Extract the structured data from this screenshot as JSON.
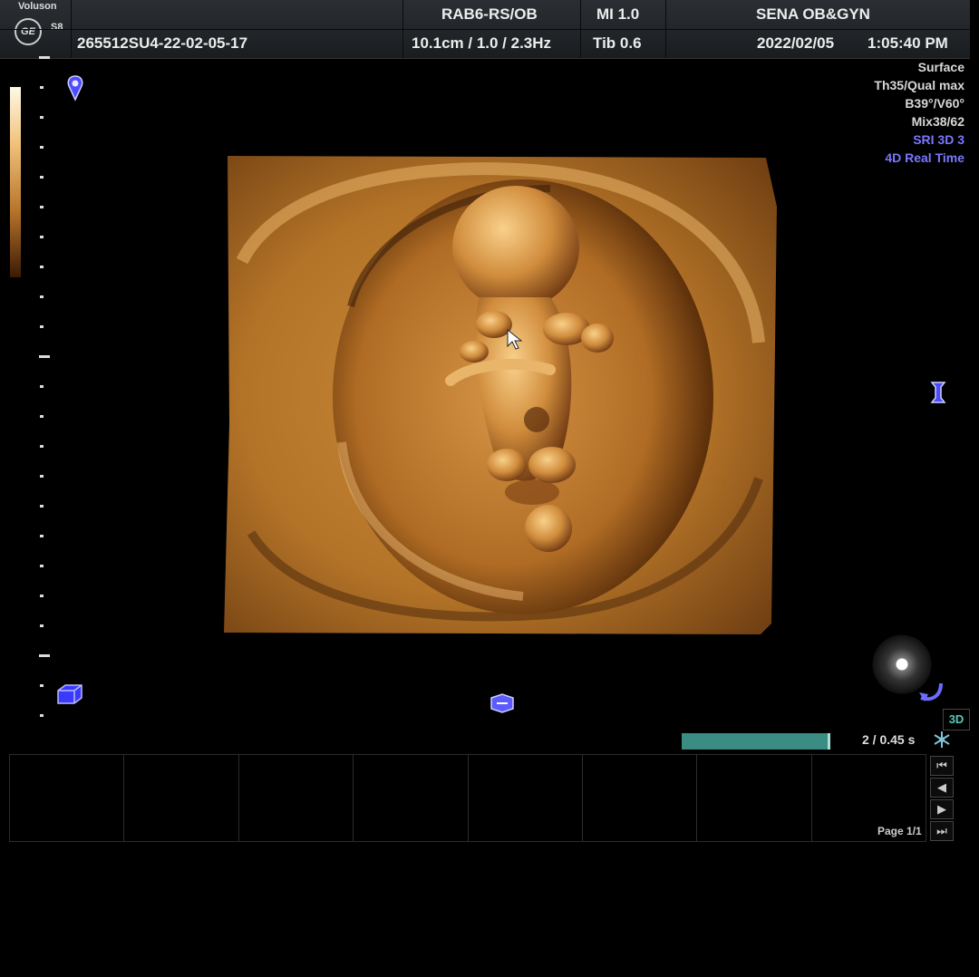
{
  "header": {
    "brand": {
      "name": "Voluson",
      "logo_text": "GE",
      "model": "S8"
    },
    "patient_id": "265512SU4-22-02-05-17",
    "probe_preset": "RAB6-RS/OB",
    "depth_freq": "10.1cm / 1.0 / 2.3Hz",
    "mi": "MI  1.0",
    "tib": "Tib  0.6",
    "institution": "SENA OB&GYN",
    "date": "2022/02/05",
    "time": "1:05:40 PM"
  },
  "parameters": [
    {
      "text": "Surface",
      "color": "#d8d8d8"
    },
    {
      "text": "Th35/Qual max",
      "color": "#d8d8d8"
    },
    {
      "text": "B39°/V60°",
      "color": "#d8d8d8"
    },
    {
      "text": "Mix38/62",
      "color": "#d8d8d8"
    },
    {
      "text": "SRI 3D 3",
      "color": "#7b77ff"
    },
    {
      "text": "4D Real Time",
      "color": "#7b77ff"
    }
  ],
  "icons": {
    "focus_marker": "focus-marker-icon",
    "orientation_left": "orientation-cube-icon",
    "orientation_bottom": "orientation-arrow-icon",
    "rotate": "rotate-icon",
    "vertical_flip": "vertical-flip-icon",
    "mode_3d": "3D",
    "freeze": "freeze-icon"
  },
  "cine": {
    "progress": 1.0,
    "label": "2 / 0.45 s"
  },
  "thumbnails": {
    "count": 8
  },
  "pagination": {
    "label": "Page 1/1",
    "first": "⏮",
    "prev": "◀",
    "next": "▶",
    "last": "⏭"
  },
  "colors": {
    "render_primary": "#c98a3a",
    "render_shadow": "#3d1f08",
    "render_highlight": "#f7c87c",
    "accent_blue": "#7b77ff",
    "cine_bar": "#3b8d83"
  }
}
